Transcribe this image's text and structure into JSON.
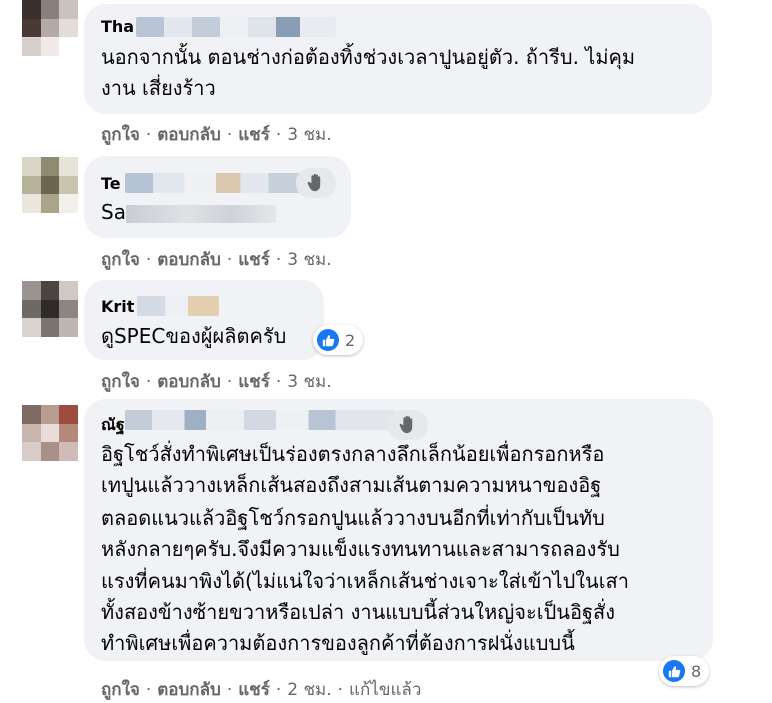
{
  "comments": [
    {
      "author": "Tha",
      "lines": [
        "นอกจากนั้น ตอนช่างก่อต้องทิ้งช่วงเวลาปูนอยู่ตัว. ถ้ารีบ. ไม่คุม",
        "งาน เสี่ยงร้าว"
      ],
      "like_label": "ถูกใจ",
      "reply_label": "ตอบกลับ",
      "share_label": "แชร์",
      "time": "3 ชม."
    },
    {
      "author": "Te",
      "lines": [
        "Sa"
      ],
      "like_label": "ถูกใจ",
      "reply_label": "ตอบกลับ",
      "share_label": "แชร์",
      "time": "3 ชม."
    },
    {
      "author": "Krit",
      "lines": [
        "ดูSPECของผู้ผลิตครับ"
      ],
      "reaction_count": "2",
      "like_label": "ถูกใจ",
      "reply_label": "ตอบกลับ",
      "share_label": "แชร์",
      "time": "3 ชม."
    },
    {
      "author": "ณัฐ",
      "lines": [
        "อิฐโชว์สั่งทำพิเศษเป็นร่องตรงกลางลึกเล็กน้อยเพื่อกรอกหรือ",
        "เทปูนแล้ววางเหล็กเส้นสองถึงสามเส้นตามความหนาของอิฐ",
        "ตลอดแนวแล้วอิฐโชว์กรอกปูนแล้ววางบนอีกที่เท่ากับเป็นทับ",
        "หลังกลายๆครับ.จึงมีความแข็งแรงทนทานและสามารถลองรับ",
        "แรงที่คนมาพิงได้(ไม่แน่ใจว่าเหล็กเส้นช่างเจาะใส่เข้าไปในเสา",
        "ทั้งสองข้างซ้ายขวาหรือเปล่า งานแบบนี้ส่วนใหญ่จะเป็นอิฐสั่ง",
        "ทำพิเศษเพื่อความต้องการของลูกค้าที่ต้องการฝนั่งแบบนี้"
      ],
      "reaction_count": "8",
      "like_label": "ถูกใจ",
      "reply_label": "ตอบกลับ",
      "share_label": "แชร์",
      "time": "2 ชม.",
      "edited": "แก้ไขแล้ว"
    }
  ],
  "icons": {
    "like": "like-icon",
    "wave": "wave-icon"
  },
  "colors": {
    "bubble": "#f0f2f5",
    "like_blue": "#1877f2",
    "meta_gray": "#65676b"
  }
}
